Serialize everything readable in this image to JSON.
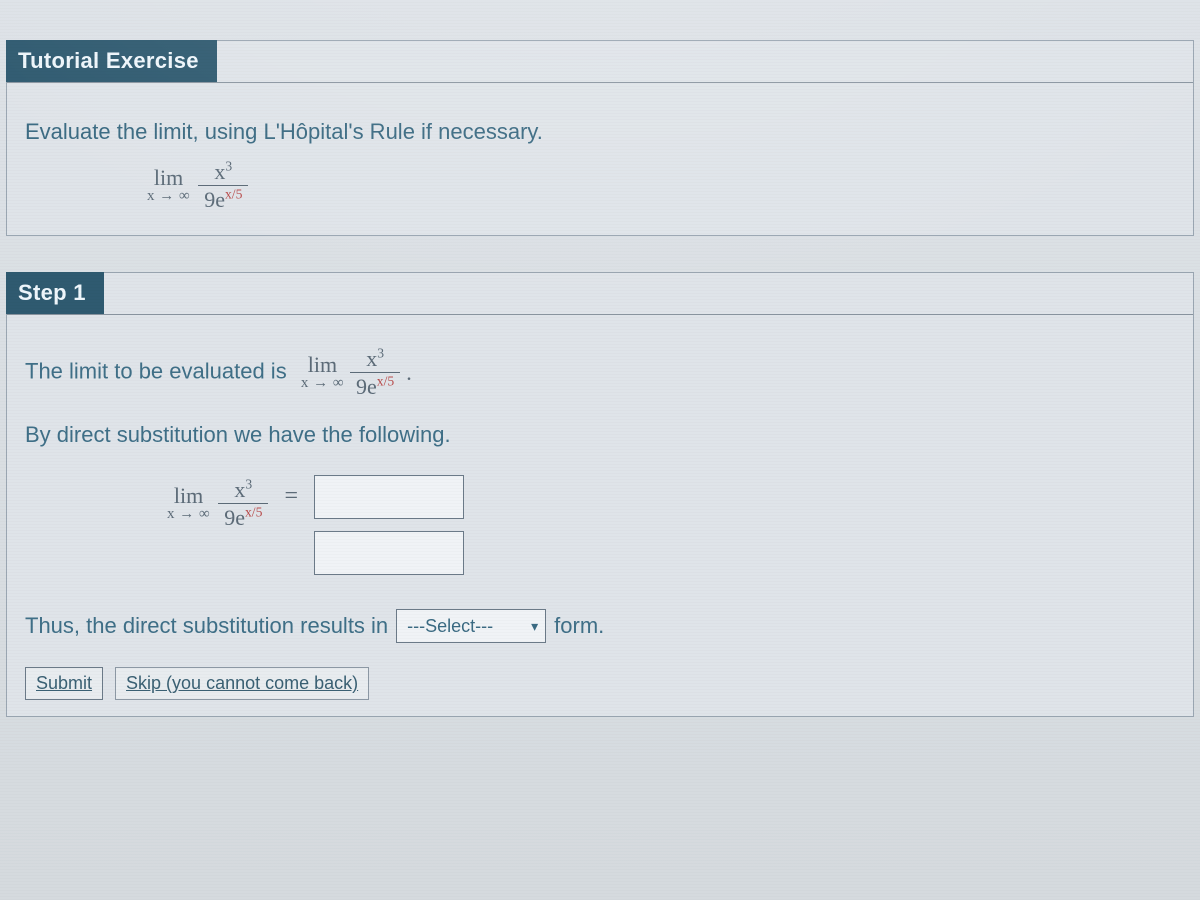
{
  "tutorial": {
    "header": "Tutorial Exercise",
    "prompt": "Evaluate the limit, using L'Hôpital's Rule if necessary.",
    "limit": {
      "lim_label": "lim",
      "approach": "x → ∞",
      "numerator_base": "x",
      "numerator_exp": "3",
      "denominator_coeff": "9e",
      "denominator_exp": "x/5"
    }
  },
  "step1": {
    "header": "Step 1",
    "line1_prefix": "The limit to be evaluated is",
    "limit": {
      "lim_label": "lim",
      "approach": "x → ∞",
      "numerator_base": "x",
      "numerator_exp": "3",
      "denominator_coeff": "9e",
      "denominator_exp": "x/5"
    },
    "period": ".",
    "line2": "By direct substitution we have the following.",
    "equals": "=",
    "answer_num_value": "",
    "answer_den_value": "",
    "line3_prefix": "Thus, the direct substitution results in",
    "select_placeholder": "---Select---",
    "line3_suffix": "form.",
    "submit_label": "Submit",
    "skip_label": "Skip (you cannot come back)"
  }
}
